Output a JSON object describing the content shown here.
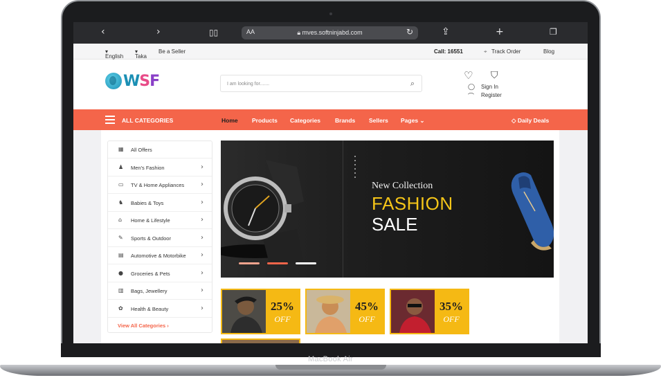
{
  "device": {
    "label": "MacBook Air"
  },
  "browser": {
    "text_size_label": "AA",
    "url": "mves.softninjabd.com",
    "icons": [
      "back-icon",
      "forward-icon",
      "bookmarks-icon",
      "lock-icon",
      "reload-icon",
      "share-icon",
      "new-tab-icon",
      "tabs-icon"
    ]
  },
  "topbar": {
    "language": "English",
    "currency": "Taka",
    "seller": "Be a Seller",
    "call": "Call: 16551",
    "track": "Track Order",
    "blog": "Blog"
  },
  "header": {
    "logo": {
      "w": "W",
      "s": "S",
      "f": "F"
    },
    "search_placeholder": "I am looking for.......",
    "sign_in": "Sign In",
    "register": "Register"
  },
  "nav": {
    "all_categories": "ALL CATEGORIES",
    "items": [
      "Home",
      "Products",
      "Categories",
      "Brands",
      "Sellers",
      "Pages"
    ],
    "deals": "Daily Deals",
    "colors": {
      "bar": "#f4654a",
      "active": "#1f1f1f"
    }
  },
  "sidebar": {
    "categories": [
      {
        "label": "All Offers",
        "icon": "offers-icon",
        "glyph": "▦",
        "chevron": false
      },
      {
        "label": "Men's Fashion",
        "icon": "man-icon",
        "glyph": "♟",
        "chevron": true
      },
      {
        "label": "TV & Home Appliances",
        "icon": "tv-icon",
        "glyph": "▭",
        "chevron": true
      },
      {
        "label": "Babies & Toys",
        "icon": "stroller-icon",
        "glyph": "♞",
        "chevron": true
      },
      {
        "label": "Home & Lifestyle",
        "icon": "home-icon",
        "glyph": "⌂",
        "chevron": true
      },
      {
        "label": "Sports & Outdoor",
        "icon": "sports-icon",
        "glyph": "✎",
        "chevron": true
      },
      {
        "label": "Automotive & Motorbike",
        "icon": "car-icon",
        "glyph": "▤",
        "chevron": true
      },
      {
        "label": "Groceries & Pets",
        "icon": "grocery-icon",
        "glyph": "●",
        "chevron": true
      },
      {
        "label": "Bags, Jewellery",
        "icon": "bag-icon",
        "glyph": "▥",
        "chevron": true
      },
      {
        "label": "Health & Beauty",
        "icon": "beauty-icon",
        "glyph": "✿",
        "chevron": true
      }
    ],
    "view_all": "View All Categories"
  },
  "banner": {
    "line1": "New Collection",
    "line2": "FASHION",
    "line3": "SALE",
    "colors": {
      "accent": "#f5c518"
    },
    "slides": 3,
    "active_slide": 2
  },
  "promos": [
    {
      "percent": "25%",
      "off": "OFF"
    },
    {
      "percent": "45%",
      "off": "OFF"
    },
    {
      "percent": "35%",
      "off": "OFF"
    }
  ]
}
